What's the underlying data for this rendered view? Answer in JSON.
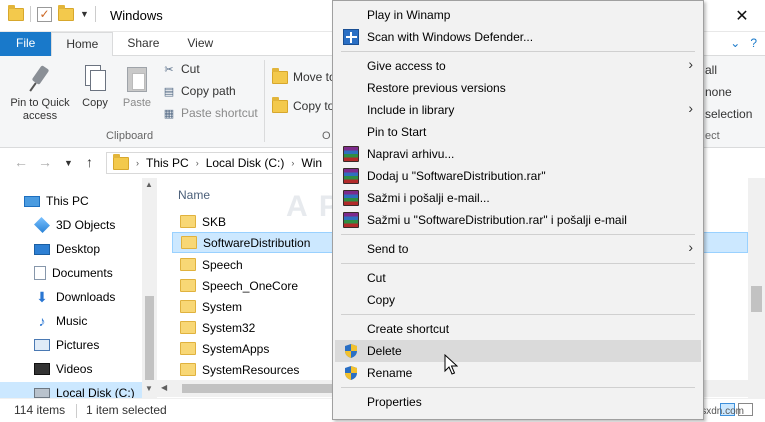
{
  "window": {
    "title": "Windows",
    "controls": {
      "close_icon": "close-icon"
    }
  },
  "ribbon_tabs": [
    {
      "label": "File"
    },
    {
      "label": "Home"
    },
    {
      "label": "Share"
    },
    {
      "label": "View"
    }
  ],
  "ribbon": {
    "clipboard": {
      "pin_label_1": "Pin to Quick",
      "pin_label_2": "access",
      "copy_label": "Copy",
      "paste_label": "Paste",
      "cut_label": "Cut",
      "copy_path_label": "Copy path",
      "paste_shortcut_label": "Paste shortcut",
      "group_label": "Clipboard"
    },
    "organize": {
      "move_to_label": "Move to",
      "copy_to_label": "Copy to",
      "group_label_partial": "O"
    },
    "select": {
      "select_all_partial": "all",
      "select_none_partial": "none",
      "invert_partial": "selection",
      "group_label_partial": "ect"
    }
  },
  "address": {
    "crumbs": [
      "This PC",
      "Local Disk (C:)",
      "Win"
    ]
  },
  "nav_pane": {
    "items": [
      {
        "label": "This PC",
        "icon": "computer-icon"
      },
      {
        "label": "3D Objects",
        "icon": "cube-icon"
      },
      {
        "label": "Desktop",
        "icon": "desktop-icon"
      },
      {
        "label": "Documents",
        "icon": "documents-icon"
      },
      {
        "label": "Downloads",
        "icon": "download-icon"
      },
      {
        "label": "Music",
        "icon": "music-icon"
      },
      {
        "label": "Pictures",
        "icon": "pictures-icon"
      },
      {
        "label": "Videos",
        "icon": "videos-icon"
      },
      {
        "label": "Local Disk (C:)",
        "icon": "disk-icon"
      }
    ]
  },
  "file_list": {
    "column_header": "Name",
    "rows": [
      {
        "name": "SKB"
      },
      {
        "name": "SoftwareDistribution"
      },
      {
        "name": "Speech"
      },
      {
        "name": "Speech_OneCore"
      },
      {
        "name": "System"
      },
      {
        "name": "System32"
      },
      {
        "name": "SystemApps"
      },
      {
        "name": "SystemResources"
      }
    ]
  },
  "status": {
    "item_count": "114 items",
    "selected": "1 item selected"
  },
  "context_menu": {
    "items": [
      {
        "label": "Play in Winamp",
        "icon": ""
      },
      {
        "label": "Scan with Windows Defender...",
        "icon": "defender-icon"
      },
      {
        "label": "Give access to",
        "submenu": true
      },
      {
        "label": "Restore previous versions"
      },
      {
        "label": "Include in library",
        "submenu": true
      },
      {
        "label": "Pin to Start"
      },
      {
        "label": "Napravi arhivu...",
        "icon": "winrar-icon"
      },
      {
        "label": "Dodaj u \"SoftwareDistribution.rar\"",
        "icon": "winrar-icon"
      },
      {
        "label": "Sažmi i pošalji e-mail...",
        "icon": "winrar-icon"
      },
      {
        "label": "Sažmi u \"SoftwareDistribution.rar\" i pošalji e-mail",
        "icon": "winrar-icon"
      },
      {
        "label": "Send to",
        "submenu": true
      },
      {
        "label": "Cut"
      },
      {
        "label": "Copy"
      },
      {
        "label": "Create shortcut"
      },
      {
        "label": "Delete",
        "icon": "shield-icon",
        "hovered": true
      },
      {
        "label": "Rename",
        "icon": "shield-icon"
      },
      {
        "label": "Properties"
      }
    ]
  },
  "watermark": "wsxdn.com",
  "colors": {
    "accent": "#1979ca",
    "selection": "#cce8ff",
    "menu_bg": "#f2f2f2",
    "menu_hover": "#dadada"
  }
}
